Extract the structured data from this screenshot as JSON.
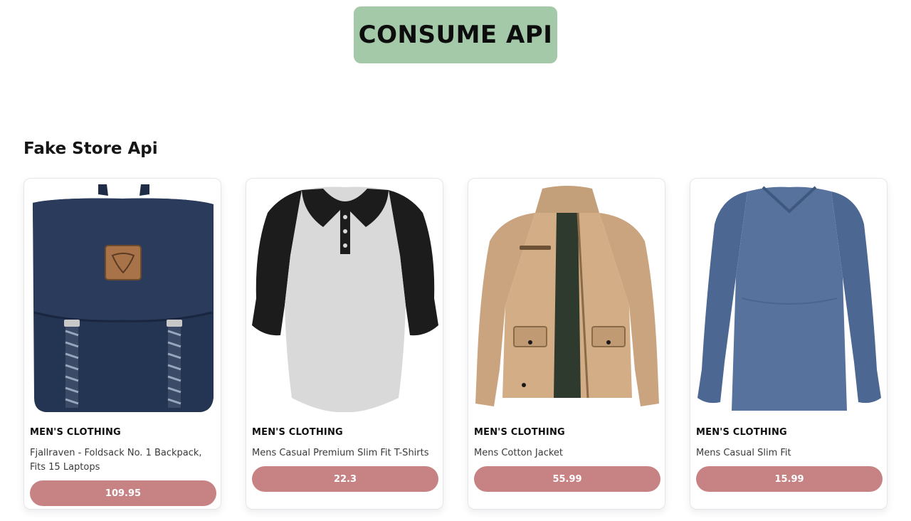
{
  "header": {
    "title": "CONSUME API",
    "background": "#a3c9a8"
  },
  "section": {
    "title": "Fake Store Api"
  },
  "accent": {
    "price_button": "#c78384"
  },
  "products": [
    {
      "category": "MEN'S CLOTHING",
      "title": "Fjallraven - Foldsack No. 1 Backpack, Fits 15 Laptops",
      "price": "109.95",
      "image_icon": "backpack-image"
    },
    {
      "category": "MEN'S CLOTHING",
      "title": "Mens Casual Premium Slim Fit T-Shirts",
      "price": "22.3",
      "image_icon": "raglan-shirt-image"
    },
    {
      "category": "MEN'S CLOTHING",
      "title": "Mens Cotton Jacket",
      "price": "55.99",
      "image_icon": "jacket-image"
    },
    {
      "category": "MEN'S CLOTHING",
      "title": "Mens Casual Slim Fit",
      "price": "15.99",
      "image_icon": "long-sleeve-tee-image"
    }
  ]
}
